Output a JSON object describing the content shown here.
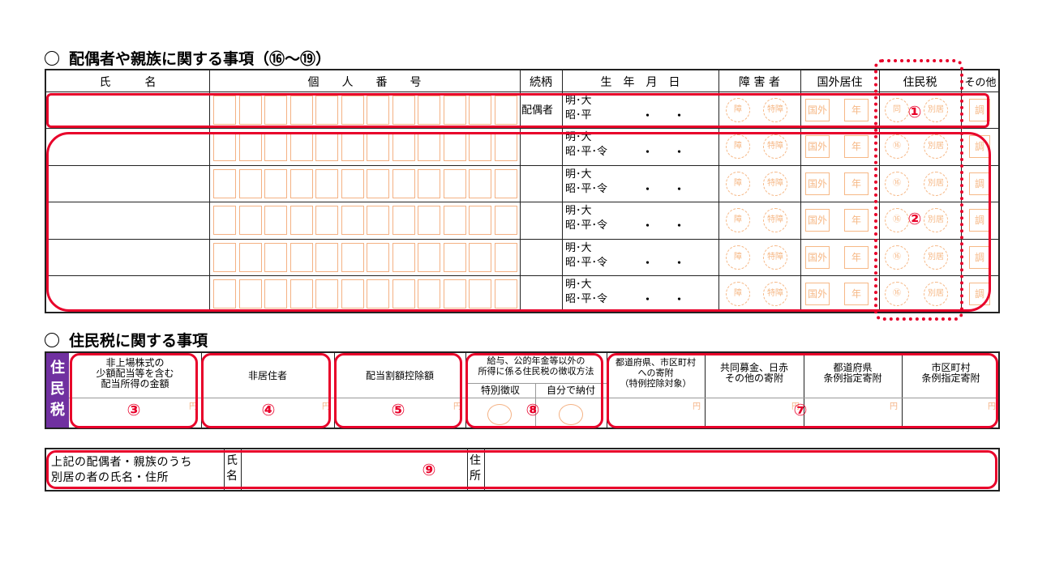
{
  "section1": {
    "title": "配偶者や親族に関する事項（⑯〜⑲）",
    "headers": {
      "name": "氏　　　名",
      "number": "個　　人　　番　　号",
      "relation": "続柄",
      "birth": "生　年　月　日",
      "disabled": "障 害 者",
      "abroad": "国外居住",
      "residence_tax": "住民税",
      "other": "その他"
    },
    "spouse_label": "配偶者",
    "era_row1": "明･大",
    "era_row2_spouse": "昭･平",
    "era_row2": "昭･平･令",
    "dots": "・　　・",
    "stamps": {
      "disabled": "障",
      "special_disabled": "特障",
      "abroad": "国外",
      "year": "年",
      "same": "同",
      "under16": "⑯",
      "separate": "別居",
      "adjust": "調"
    }
  },
  "section2": {
    "title": "住民税に関する事項",
    "side_label": "住民税",
    "headers": {
      "dividend": "非上場株式の\n少額配当等を含む\n配当所得の金額",
      "nonresident": "非居住者",
      "dividend_deduction": "配当割額控除額",
      "collection": "給与、公的年金等以外の\n所得に係る住民税の徴収方法",
      "special_collection": "特別徴収",
      "self_payment": "自分で納付",
      "pref_donation": "都道府県、市区町村\nへの寄附\n（特例控除対象）",
      "community_chest": "共同募金、日赤\nその他の寄附",
      "pref_ordinance": "都道府県\n条例指定寄附",
      "city_ordinance": "市区町村\n条例指定寄附"
    },
    "yen": "円"
  },
  "section3": {
    "label": "上記の配偶者・親族のうち\n別居の者の氏名・住所",
    "name_label": "氏\n名",
    "address_label": "住\n所"
  },
  "annotations": [
    "①",
    "②",
    "③",
    "④",
    "⑤",
    "⑦",
    "⑧",
    "⑨"
  ],
  "colors": {
    "annotation": "#e8002a",
    "form_orange": "#f4b183",
    "side_purple": "#7030a0"
  }
}
